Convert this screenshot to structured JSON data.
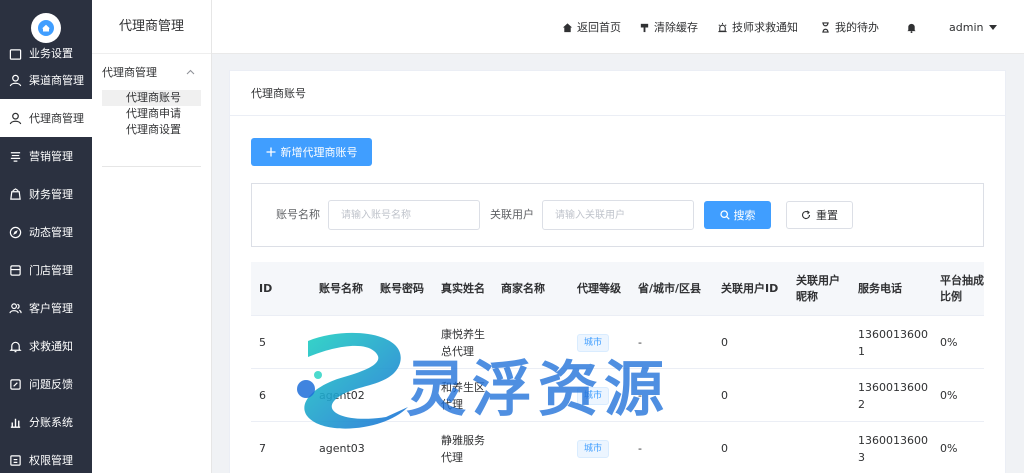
{
  "sidebar": {
    "items": [
      {
        "label": "业务设置",
        "icon": "settings-icon"
      },
      {
        "label": "渠道商管理",
        "icon": "user-icon"
      },
      {
        "label": "代理商管理",
        "icon": "user-icon",
        "active": true
      },
      {
        "label": "营销管理",
        "icon": "marketing-icon"
      },
      {
        "label": "财务管理",
        "icon": "finance-icon"
      },
      {
        "label": "动态管理",
        "icon": "compass-icon"
      },
      {
        "label": "门店管理",
        "icon": "store-icon"
      },
      {
        "label": "客户管理",
        "icon": "users-icon"
      },
      {
        "label": "求救通知",
        "icon": "bell-icon"
      },
      {
        "label": "问题反馈",
        "icon": "feedback-icon"
      },
      {
        "label": "分账系统",
        "icon": "chart-icon"
      },
      {
        "label": "权限管理",
        "icon": "permission-icon"
      }
    ]
  },
  "subsidebar": {
    "title": "代理商管理",
    "group": "代理商管理",
    "items": [
      "代理商账号",
      "代理商申请",
      "代理商设置"
    ]
  },
  "topbar": {
    "home": "返回首页",
    "clear_cache": "清除缓存",
    "sos": "技师求救通知",
    "todo": "我的待办",
    "user": "admin"
  },
  "page": {
    "title": "代理商账号",
    "add_button": "新增代理商账号"
  },
  "filter": {
    "account_label": "账号名称",
    "account_placeholder": "请输入账号名称",
    "user_label": "关联用户",
    "user_placeholder": "请输入关联用户",
    "search": "搜索",
    "reset": "重置"
  },
  "table": {
    "headers": [
      "ID",
      "账号名称",
      "账号密码",
      "真实姓名",
      "商家名称",
      "代理等级",
      "省/城市/区县",
      "关联用户ID",
      "关联用户昵称",
      "服务电话",
      "平台抽成比例"
    ],
    "rows": [
      {
        "id": "5",
        "account": "",
        "password": "",
        "real_name": "康悦养生总代理",
        "merchant": "",
        "level": "城市",
        "region": "-",
        "uid": "0",
        "nickname": "",
        "phone": "13600136001",
        "ratio": "0%"
      },
      {
        "id": "6",
        "account": "agent02",
        "password": "",
        "real_name": "和养生区代理",
        "merchant": "",
        "level": "城市",
        "region": "-",
        "uid": "0",
        "nickname": "",
        "phone": "13600136002",
        "ratio": "0%"
      },
      {
        "id": "7",
        "account": "agent03",
        "password": "",
        "real_name": "静雅服务代理",
        "merchant": "",
        "level": "城市",
        "region": "-",
        "uid": "0",
        "nickname": "",
        "phone": "13600136003",
        "ratio": "0%"
      }
    ]
  },
  "watermark": {
    "text": "灵浮资源"
  },
  "colors": {
    "primary": "#409eff",
    "sidebar_bg": "#2b3140"
  }
}
